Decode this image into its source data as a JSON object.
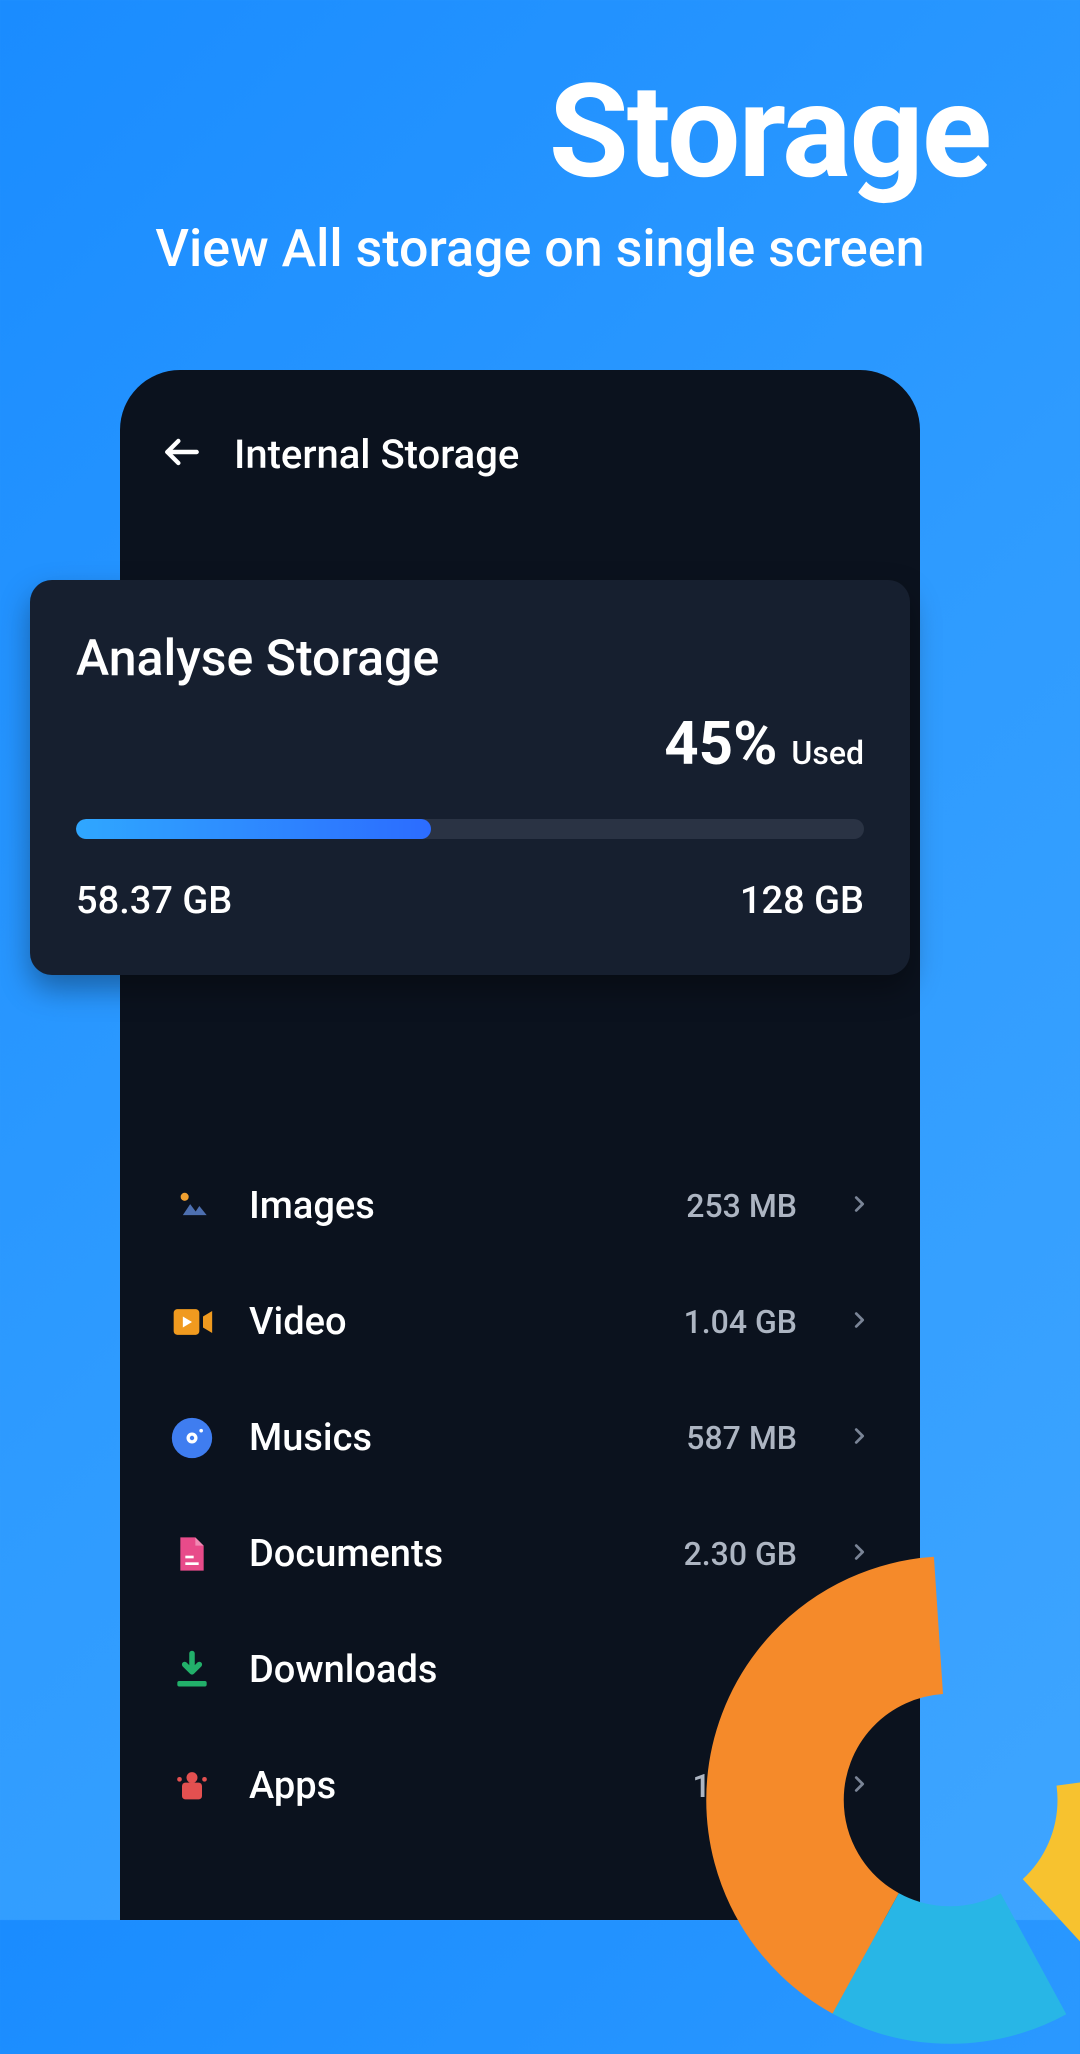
{
  "hero": {
    "title": "Storage",
    "subtitle": "View All storage on single screen"
  },
  "header": {
    "title": "Internal Storage"
  },
  "card": {
    "title": "Analyse Storage",
    "percent": "45%",
    "percent_label": "Used",
    "used": "58.37 GB",
    "total": "128 GB",
    "fill_pct": 45
  },
  "categories": [
    {
      "id": "images",
      "label": "Images",
      "size": "253 MB",
      "icon": "images-icon",
      "color": "#4d6fb0"
    },
    {
      "id": "video",
      "label": "Video",
      "size": "1.04 GB",
      "icon": "video-icon",
      "color": "#f09a1f"
    },
    {
      "id": "musics",
      "label": "Musics",
      "size": "587 MB",
      "icon": "music-icon",
      "color": "#3f7df0"
    },
    {
      "id": "documents",
      "label": "Documents",
      "size": "2.30 GB",
      "icon": "document-icon",
      "color": "#e84b8a"
    },
    {
      "id": "downloads",
      "label": "Downloads",
      "size": "",
      "icon": "download-icon",
      "color": "#22b06a"
    },
    {
      "id": "apps",
      "label": "Apps",
      "size": "120 GB",
      "icon": "apps-icon",
      "color": "#e35050"
    }
  ]
}
